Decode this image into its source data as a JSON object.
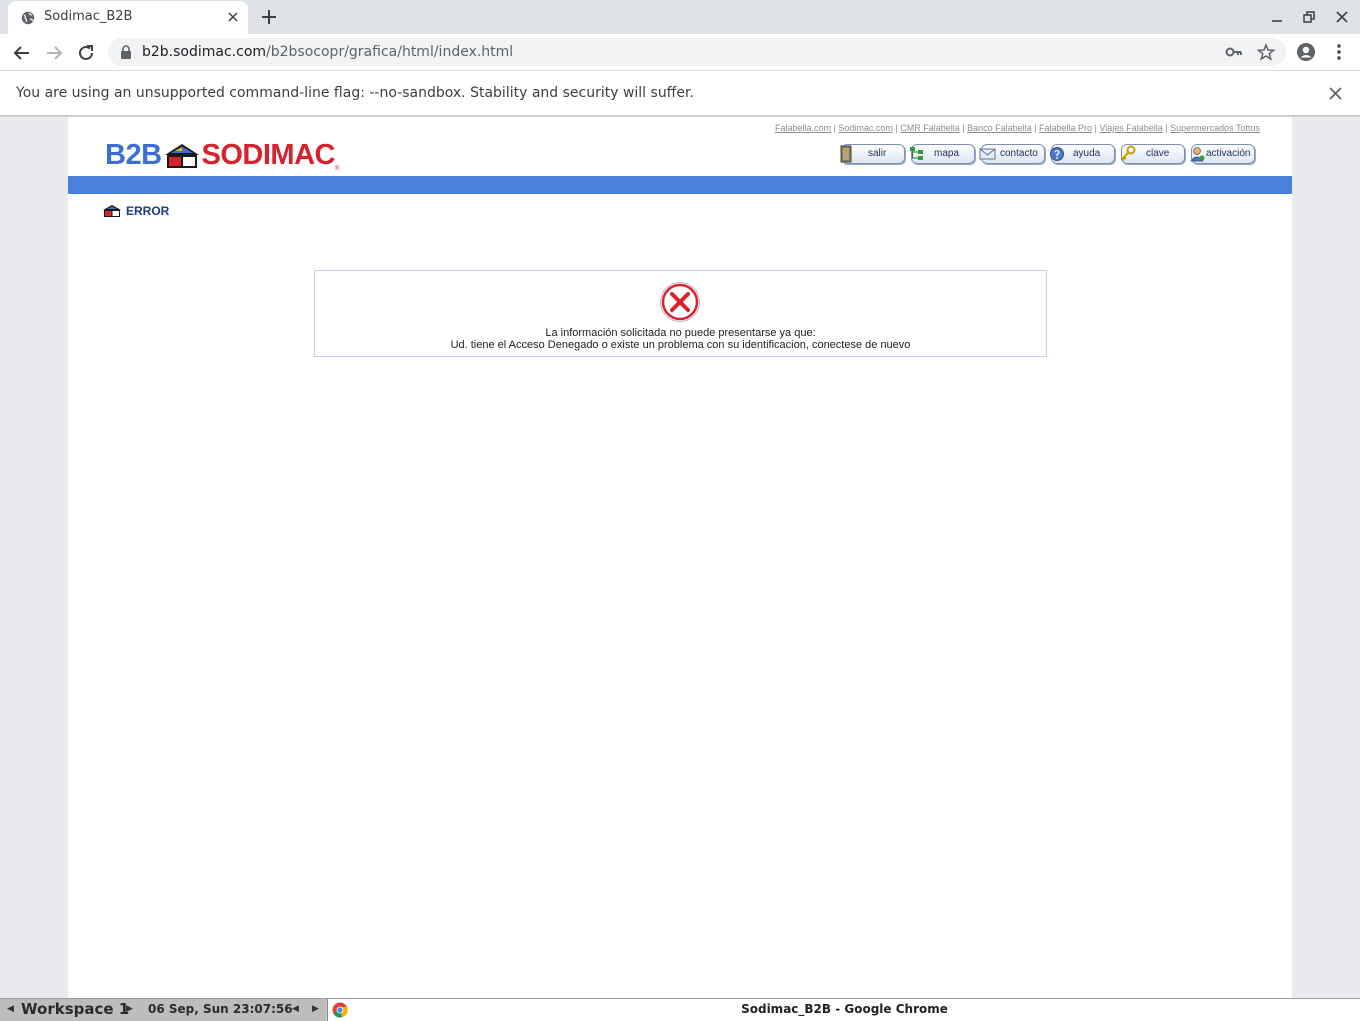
{
  "browser": {
    "tab_title": "Sodimac_B2B",
    "url_host": "b2b.sodimac.com",
    "url_path": "/b2bsocopr/grafica/html/index.html",
    "infobar_message": "You are using an unsupported command-line flag: --no-sandbox. Stability and security will suffer."
  },
  "header": {
    "toplinks": [
      "Falabella.com",
      "Sodimac.com",
      "CMR Falabella",
      "Banco Falabella",
      "Falabella Pro",
      "Viajes Falabella",
      "Supermercados Tottus"
    ],
    "logo_prefix": "B2B",
    "logo_brand": "SODIMAC",
    "logo_reg": "®",
    "nav_buttons": [
      {
        "label": "salir",
        "icon": "door-icon"
      },
      {
        "label": "mapa",
        "icon": "sitemap-icon"
      },
      {
        "label": "contacto",
        "icon": "envelope-icon"
      },
      {
        "label": "ayuda",
        "icon": "help-icon"
      },
      {
        "label": "clave",
        "icon": "key-icon"
      },
      {
        "label": "activación",
        "icon": "user-icon"
      }
    ]
  },
  "section": {
    "title": "ERROR"
  },
  "error": {
    "icon": "error-x-icon",
    "line1": "La información solicitada no puede presentarse ya que:",
    "line2": "Ud. tiene el Acceso Denegado o existe un problema con su identificacion, conectese de nuevo"
  },
  "taskbar": {
    "workspace": "Workspace 1",
    "clock": "06 Sep, Sun 23:07:56",
    "window_title": "Sodimac_B2B - Google Chrome"
  },
  "colors": {
    "bluebar": "#4a7fdb",
    "brand_red": "#d8222b",
    "brand_blue": "#3b6fd1",
    "error_red": "#d8222b"
  }
}
